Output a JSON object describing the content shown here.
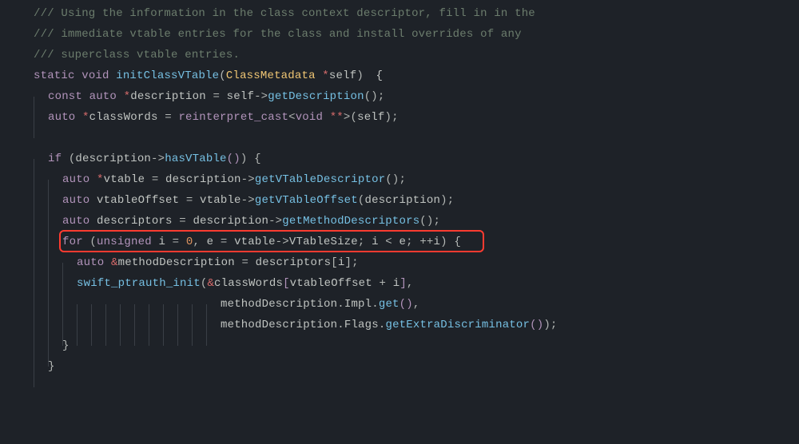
{
  "colors": {
    "background": "#1e2228",
    "comment": "#6c7d6d",
    "keyword": "#b294bb",
    "type": "#f0c674",
    "function": "#76c0e3",
    "deref": "#d66b6b",
    "punctuation": "#b3b7b4",
    "identifier": "#c0c4c1",
    "number": "#de935f",
    "highlight_border": "#ff3b30"
  },
  "highlight_line_index": 10,
  "code": {
    "lines": [
      {
        "indent": 0,
        "tokens": [
          {
            "t": "/// Using the information in the class context descriptor, fill in in the",
            "c": "comment"
          }
        ]
      },
      {
        "indent": 0,
        "tokens": [
          {
            "t": "/// immediate vtable entries for the class and install overrides of any",
            "c": "comment"
          }
        ]
      },
      {
        "indent": 0,
        "tokens": [
          {
            "t": "/// superclass vtable entries.",
            "c": "comment"
          }
        ]
      },
      {
        "indent": 0,
        "tokens": [
          {
            "t": "static ",
            "c": "kw"
          },
          {
            "t": "void ",
            "c": "kw"
          },
          {
            "t": "initClassVTable",
            "c": "func"
          },
          {
            "t": "(",
            "c": "punc"
          },
          {
            "t": "ClassMetadata ",
            "c": "type"
          },
          {
            "t": "*",
            "c": "deref"
          },
          {
            "t": "self",
            "c": "var"
          },
          {
            "t": ")",
            "c": "punc"
          },
          {
            "t": " ",
            "c": "punc"
          },
          {
            "t": "{",
            "c": "cursor"
          }
        ]
      },
      {
        "indent": 1,
        "tokens": [
          {
            "t": "const ",
            "c": "kw"
          },
          {
            "t": "auto ",
            "c": "kw"
          },
          {
            "t": "*",
            "c": "deref"
          },
          {
            "t": "description ",
            "c": "var"
          },
          {
            "t": "= ",
            "c": "punc"
          },
          {
            "t": "self",
            "c": "var"
          },
          {
            "t": "->",
            "c": "punc"
          },
          {
            "t": "getDescription",
            "c": "func"
          },
          {
            "t": "()",
            "c": "punc"
          },
          {
            "t": ";",
            "c": "punc"
          }
        ]
      },
      {
        "indent": 1,
        "tokens": [
          {
            "t": "auto ",
            "c": "kw"
          },
          {
            "t": "*",
            "c": "deref"
          },
          {
            "t": "classWords ",
            "c": "var"
          },
          {
            "t": "= ",
            "c": "punc"
          },
          {
            "t": "reinterpret_cast",
            "c": "kw"
          },
          {
            "t": "<",
            "c": "punc"
          },
          {
            "t": "void ",
            "c": "kw"
          },
          {
            "t": "**",
            "c": "deref"
          },
          {
            "t": ">(",
            "c": "punc"
          },
          {
            "t": "self",
            "c": "var"
          },
          {
            "t": ")",
            "c": "punc"
          },
          {
            "t": ";",
            "c": "punc"
          }
        ]
      },
      {
        "indent": 0,
        "tokens": [
          {
            "t": " ",
            "c": "var"
          }
        ]
      },
      {
        "indent": 1,
        "tokens": [
          {
            "t": "if ",
            "c": "kw"
          },
          {
            "t": "(",
            "c": "punc"
          },
          {
            "t": "description",
            "c": "var"
          },
          {
            "t": "->",
            "c": "punc"
          },
          {
            "t": "hasVTable",
            "c": "func"
          },
          {
            "t": "()",
            "c": "paren2"
          },
          {
            "t": ")",
            "c": "punc"
          },
          {
            "t": " {",
            "c": "punc"
          }
        ]
      },
      {
        "indent": 2,
        "tokens": [
          {
            "t": "auto ",
            "c": "kw"
          },
          {
            "t": "*",
            "c": "deref"
          },
          {
            "t": "vtable ",
            "c": "var"
          },
          {
            "t": "= ",
            "c": "punc"
          },
          {
            "t": "description",
            "c": "var"
          },
          {
            "t": "->",
            "c": "punc"
          },
          {
            "t": "getVTableDescriptor",
            "c": "func"
          },
          {
            "t": "()",
            "c": "punc"
          },
          {
            "t": ";",
            "c": "punc"
          }
        ]
      },
      {
        "indent": 2,
        "tokens": [
          {
            "t": "auto ",
            "c": "kw"
          },
          {
            "t": "vtableOffset ",
            "c": "var"
          },
          {
            "t": "= ",
            "c": "punc"
          },
          {
            "t": "vtable",
            "c": "var"
          },
          {
            "t": "->",
            "c": "punc"
          },
          {
            "t": "getVTableOffset",
            "c": "func"
          },
          {
            "t": "(",
            "c": "punc"
          },
          {
            "t": "description",
            "c": "var"
          },
          {
            "t": ")",
            "c": "punc"
          },
          {
            "t": ";",
            "c": "punc"
          }
        ]
      },
      {
        "indent": 2,
        "tokens": [
          {
            "t": "auto ",
            "c": "kw"
          },
          {
            "t": "descriptors ",
            "c": "var"
          },
          {
            "t": "= ",
            "c": "punc"
          },
          {
            "t": "description",
            "c": "var"
          },
          {
            "t": "->",
            "c": "punc"
          },
          {
            "t": "getMethodDescriptors",
            "c": "func"
          },
          {
            "t": "()",
            "c": "punc"
          },
          {
            "t": ";",
            "c": "punc"
          }
        ]
      },
      {
        "indent": 2,
        "tokens": [
          {
            "t": "for ",
            "c": "kw"
          },
          {
            "t": "(",
            "c": "punc"
          },
          {
            "t": "unsigned ",
            "c": "kw"
          },
          {
            "t": "i ",
            "c": "var"
          },
          {
            "t": "= ",
            "c": "punc"
          },
          {
            "t": "0",
            "c": "num"
          },
          {
            "t": ", ",
            "c": "punc"
          },
          {
            "t": "e ",
            "c": "var"
          },
          {
            "t": "= ",
            "c": "punc"
          },
          {
            "t": "vtable",
            "c": "var"
          },
          {
            "t": "->",
            "c": "punc"
          },
          {
            "t": "VTableSize",
            "c": "var"
          },
          {
            "t": "; ",
            "c": "punc"
          },
          {
            "t": "i ",
            "c": "var"
          },
          {
            "t": "< ",
            "c": "punc"
          },
          {
            "t": "e",
            "c": "var"
          },
          {
            "t": "; ",
            "c": "punc"
          },
          {
            "t": "++",
            "c": "punc"
          },
          {
            "t": "i",
            "c": "var"
          },
          {
            "t": ")",
            "c": "punc"
          },
          {
            "t": " {",
            "c": "punc"
          }
        ]
      },
      {
        "indent": 3,
        "tokens": [
          {
            "t": "auto ",
            "c": "kw"
          },
          {
            "t": "&",
            "c": "deref"
          },
          {
            "t": "methodDescription ",
            "c": "var"
          },
          {
            "t": "= ",
            "c": "punc"
          },
          {
            "t": "descriptors",
            "c": "var"
          },
          {
            "t": "[",
            "c": "punc"
          },
          {
            "t": "i",
            "c": "var"
          },
          {
            "t": "]",
            "c": "punc"
          },
          {
            "t": ";",
            "c": "punc"
          }
        ]
      },
      {
        "indent": 3,
        "tokens": [
          {
            "t": "swift_ptrauth_init",
            "c": "func"
          },
          {
            "t": "(",
            "c": "punc"
          },
          {
            "t": "&",
            "c": "deref"
          },
          {
            "t": "classWords",
            "c": "var"
          },
          {
            "t": "[",
            "c": "paren2"
          },
          {
            "t": "vtableOffset ",
            "c": "var"
          },
          {
            "t": "+ ",
            "c": "punc"
          },
          {
            "t": "i",
            "c": "var"
          },
          {
            "t": "]",
            "c": "paren2"
          },
          {
            "t": ",",
            "c": "punc"
          }
        ]
      },
      {
        "indent": 13,
        "tokens": [
          {
            "t": "methodDescription",
            "c": "var"
          },
          {
            "t": ".",
            "c": "punc"
          },
          {
            "t": "Impl",
            "c": "var"
          },
          {
            "t": ".",
            "c": "punc"
          },
          {
            "t": "get",
            "c": "func"
          },
          {
            "t": "()",
            "c": "paren2"
          },
          {
            "t": ",",
            "c": "punc"
          }
        ]
      },
      {
        "indent": 13,
        "tokens": [
          {
            "t": "methodDescription",
            "c": "var"
          },
          {
            "t": ".",
            "c": "punc"
          },
          {
            "t": "Flags",
            "c": "var"
          },
          {
            "t": ".",
            "c": "punc"
          },
          {
            "t": "getExtraDiscriminator",
            "c": "func"
          },
          {
            "t": "()",
            "c": "paren2"
          },
          {
            "t": ")",
            "c": "punc"
          },
          {
            "t": ";",
            "c": "punc"
          }
        ]
      },
      {
        "indent": 2,
        "tokens": [
          {
            "t": "}",
            "c": "punc"
          }
        ]
      },
      {
        "indent": 1,
        "tokens": [
          {
            "t": "}",
            "c": "punc"
          }
        ]
      }
    ]
  }
}
